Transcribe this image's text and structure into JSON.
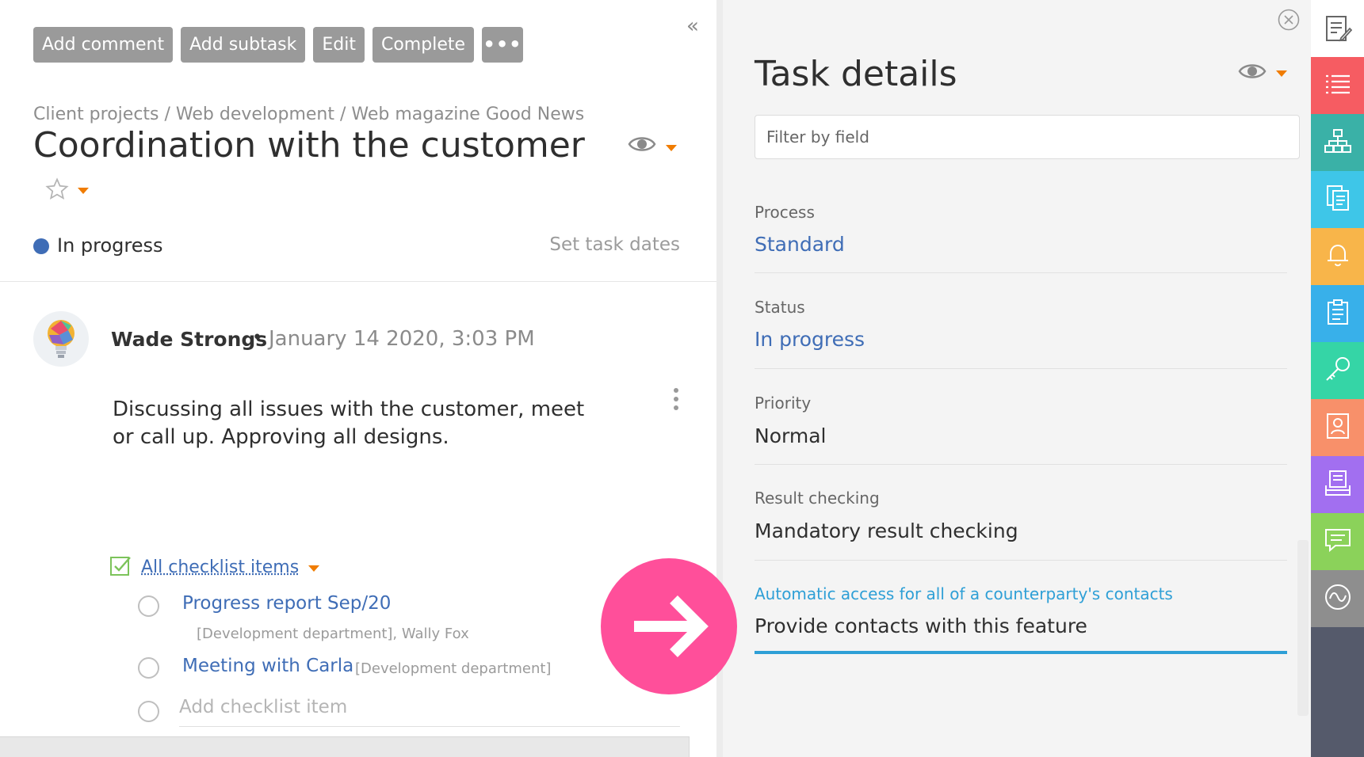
{
  "toolbar": {
    "add_comment": "Add comment",
    "add_subtask": "Add subtask",
    "edit": "Edit",
    "complete": "Complete",
    "more": "•••"
  },
  "collapse_label": "«",
  "breadcrumb": "Client projects / Web development / Web magazine Good News",
  "title": "Coordination with the customer",
  "status": {
    "label": "In progress",
    "color": "#3f6db6"
  },
  "set_task_dates": "Set task dates",
  "comment": {
    "author": "Wade Strongs",
    "bullet": "•",
    "date": "January 14 2020, 3:03 PM",
    "body": "Discussing all issues with the customer, meet or call up. Approving all designs."
  },
  "checklist": {
    "header": "All checklist items",
    "items": [
      {
        "title": "Progress report Sep/20",
        "meta": "[Development department], Wally Fox"
      },
      {
        "title": "Meeting with Carla",
        "meta": "[Development department]"
      }
    ],
    "add_placeholder": "Add checklist item"
  },
  "details": {
    "title": "Task details",
    "filter_placeholder": "Filter by field",
    "fields": [
      {
        "label": "Process",
        "value": "Standard"
      },
      {
        "label": "Status",
        "value": "In progress"
      },
      {
        "label": "Priority",
        "value": "Normal"
      },
      {
        "label": "Result checking",
        "value": "Mandatory result checking"
      },
      {
        "label": "Automatic access for all of a counterparty's contacts",
        "value": "Provide contacts with this feature"
      }
    ]
  },
  "rail": [
    {
      "icon": "list-icon",
      "color": "#f65c62"
    },
    {
      "icon": "org-chart-icon",
      "color": "#3ab1a7"
    },
    {
      "icon": "documents-icon",
      "color": "#3ec6e8"
    },
    {
      "icon": "bell-icon",
      "color": "#f8b54a"
    },
    {
      "icon": "clipboard-icon",
      "color": "#38b0ea"
    },
    {
      "icon": "key-icon",
      "color": "#35d5a6"
    },
    {
      "icon": "contact-card-icon",
      "color": "#f8906a"
    },
    {
      "icon": "inbox-icon",
      "color": "#a26ff0"
    },
    {
      "icon": "chat-icon",
      "color": "#8bd25a"
    },
    {
      "icon": "activity-icon",
      "color": "#8e8e8e"
    }
  ],
  "colors": {
    "accent_link": "#3f6db6",
    "accent_orange": "#f07c00",
    "active_field_line": "#2e9fd6",
    "overlay_circle": "#ff4f9a"
  }
}
